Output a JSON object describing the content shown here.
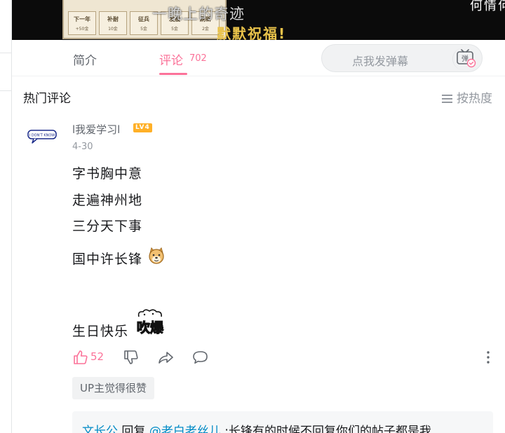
{
  "video": {
    "subtitle_line1": "一晚上的奇迹",
    "subtitle_line2": "默默祝福!",
    "right_text": "何情何",
    "game_tiny": "3金",
    "game_buttons": [
      {
        "title": "下一年",
        "cost": "+50金"
      },
      {
        "title": "补耐",
        "cost": "10金"
      },
      {
        "title": "征兵",
        "cost": "5金"
      },
      {
        "title": "发展",
        "cost": "5金"
      },
      {
        "title": "刷新",
        "cost": "2金"
      }
    ]
  },
  "tabs": {
    "intro": "简介",
    "comments": "评论",
    "comment_count": "702"
  },
  "danmaku": {
    "placeholder": "点我发弹幕",
    "icon": "danmaku-toggle-icon"
  },
  "hot": {
    "title": "热门评论",
    "sort_label": "按热度"
  },
  "comment": {
    "username": "l我爱学习l",
    "level": "LV4",
    "date": "4-30",
    "lines": [
      "字书胸中意",
      "走遍神州地",
      "三分天下事",
      "国中许长锋",
      "生日快乐"
    ],
    "avatar_text": "I DON'T KNOW",
    "like_count": "52",
    "up_badge": "UP主觉得很赞"
  },
  "reply": {
    "author": "文长公",
    "verb": " 回复 ",
    "mention": "@老白老丝儿",
    "text": " :长锋有的时候不回复你们的帖子都是我"
  },
  "colors": {
    "accent": "#fb7299",
    "link": "#008ac5",
    "level_badge": "#ffb027"
  }
}
